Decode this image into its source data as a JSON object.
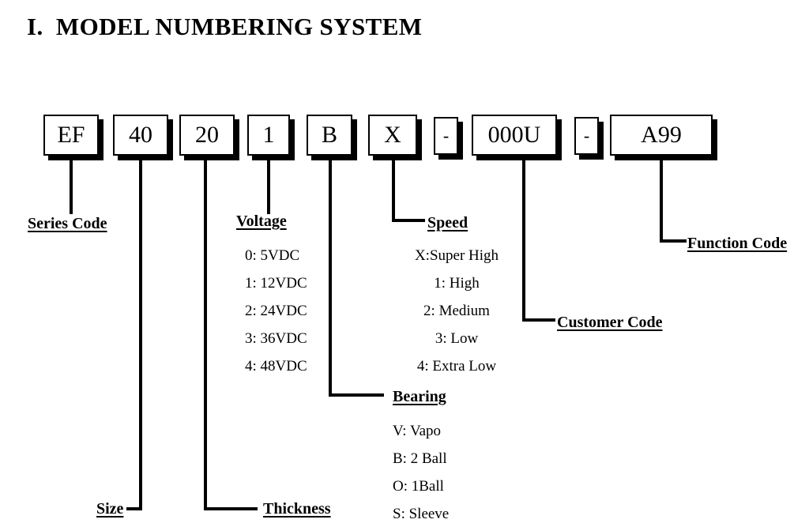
{
  "document": {
    "title": "I.  MODEL NUMBERING SYSTEM"
  },
  "model_string": {
    "boxes": [
      {
        "id": "series",
        "value": "EF",
        "field": "Series Code"
      },
      {
        "id": "size",
        "value": "40",
        "field": "Size"
      },
      {
        "id": "thickness",
        "value": "20",
        "field": "Thickness"
      },
      {
        "id": "voltage",
        "value": "1",
        "field": "Voltage"
      },
      {
        "id": "bearing",
        "value": "B",
        "field": "Bearing"
      },
      {
        "id": "speed",
        "value": "X",
        "field": "Speed"
      },
      {
        "id": "dash1",
        "value": "-",
        "field": ""
      },
      {
        "id": "customer",
        "value": "000U",
        "field": "Customer Code"
      },
      {
        "id": "dash2",
        "value": "-",
        "field": ""
      },
      {
        "id": "function",
        "value": "A99",
        "field": "Function Code"
      }
    ]
  },
  "labels": {
    "series_code": "Series Code",
    "size": "Size",
    "thickness": "Thickness",
    "voltage": "Voltage",
    "bearing": "Bearing",
    "speed": "Speed",
    "customer_code": "Customer Code",
    "function_code": "Function Code"
  },
  "legends": {
    "voltage": [
      "0: 5VDC",
      "1: 12VDC",
      "2: 24VDC",
      "3: 36VDC",
      "4: 48VDC"
    ],
    "speed": [
      "X:Super High",
      "1: High",
      "2: Medium",
      "3: Low",
      "4: Extra Low"
    ],
    "bearing": [
      "V: Vapo",
      "B: 2 Ball",
      "O: 1Ball",
      "S: Sleeve"
    ]
  },
  "colors": {
    "ink": "#000000",
    "paper": "#ffffff"
  }
}
